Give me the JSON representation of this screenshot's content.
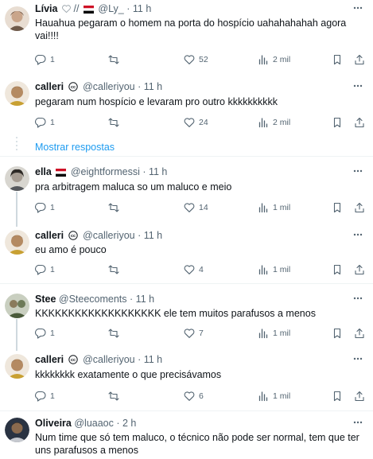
{
  "tweets": [
    {
      "name": "Lívia",
      "handle": "// ",
      "handle2": "@Ly_",
      "time": "· 11 h",
      "text": "Hauahua pegaram o homem na porta do hospício uahahahahah agora vai!!!!",
      "reply": "1",
      "retweet": "",
      "like": "52",
      "views": "2 mil",
      "avatar_color": "#c9a58a"
    },
    {
      "name": "calleri",
      "handle": "@calleriyou",
      "time": "· 11 h",
      "text": "pegaram num hospício e levaram pro outro kkkkkkkkkk",
      "reply": "1",
      "retweet": "",
      "like": "24",
      "views": "2 mil",
      "avatar_color": "#b48a62"
    },
    {
      "name": "ella",
      "handle": "@eightformessi",
      "time": "· 11 h",
      "text": "pra arbitragem maluca so um maluco e meio",
      "reply": "1",
      "retweet": "",
      "like": "14",
      "views": "1 mil",
      "avatar_color": "#8c8c86"
    },
    {
      "name": "calleri",
      "handle": "@calleriyou",
      "time": "· 11 h",
      "text": "eu amo é pouco",
      "reply": "1",
      "retweet": "",
      "like": "4",
      "views": "1 mil",
      "avatar_color": "#b48a62"
    },
    {
      "name": "Stee",
      "handle": "@Steecoments",
      "time": "· 11 h",
      "text": "KKKKKKKKKKKKKKKKKKK ele tem muitos parafusos a menos",
      "reply": "1",
      "retweet": "",
      "like": "7",
      "views": "1 mil",
      "avatar_color": "#7a8a6a"
    },
    {
      "name": "calleri",
      "handle": "@calleriyou",
      "time": "· 11 h",
      "text": "kkkkkkkk exatamente o que precisávamos",
      "reply": "1",
      "retweet": "",
      "like": "6",
      "views": "1 mil",
      "avatar_color": "#b48a62"
    },
    {
      "name": "Oliveira",
      "handle": "@luaaoc",
      "time": "· 2 h",
      "text": "Num time que só tem maluco, o técnico não pode ser normal, tem que ter uns parafusos a menos",
      "avatar_color": "#3f4a5c"
    }
  ],
  "show_replies": "Mostrar respostas",
  "colors": {
    "accent": "#1d9bf0",
    "muted": "#536471",
    "text": "#0f1419",
    "divider": "#eff3f4"
  },
  "icons": [
    "more-icon",
    "reply-icon",
    "retweet-icon",
    "like-icon",
    "views-icon",
    "bookmark-icon",
    "share-icon",
    "heart-icon",
    "flag-icon",
    "cc-icon"
  ]
}
